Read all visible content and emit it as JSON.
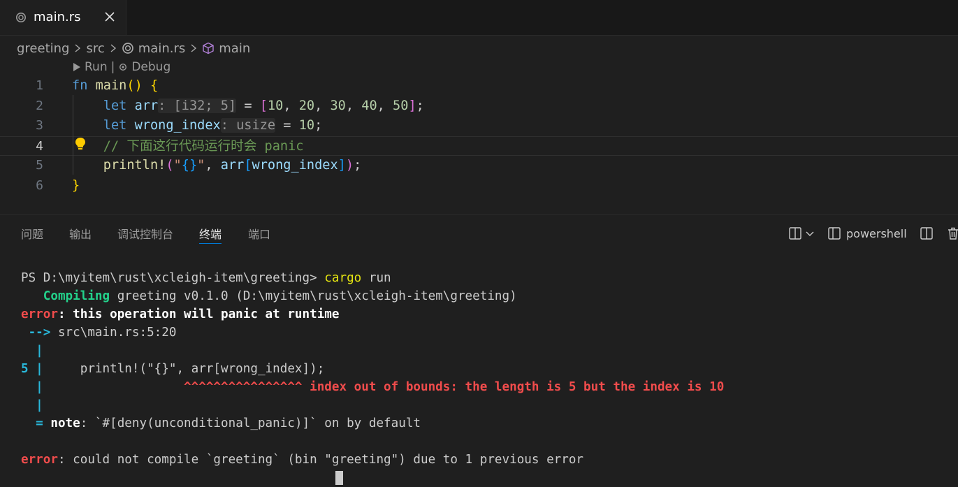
{
  "tab": {
    "label": "main.rs"
  },
  "breadcrumb": [
    "greeting",
    "src",
    "main.rs",
    "main"
  ],
  "codelens": {
    "run": "Run",
    "sep": "|",
    "debug": "Debug"
  },
  "editor": {
    "line_numbers": [
      "1",
      "2",
      "3",
      "4",
      "5",
      "6"
    ],
    "active_line": "4",
    "lines": [
      [
        [
          "kw",
          "fn"
        ],
        [
          "pun",
          " "
        ],
        [
          "fn",
          "main"
        ],
        [
          "br1",
          "()"
        ],
        [
          "pun",
          " "
        ],
        [
          "br1",
          "{"
        ]
      ],
      [
        [
          "pun",
          "    "
        ],
        [
          "kw",
          "let"
        ],
        [
          "pun",
          " "
        ],
        [
          "var",
          "arr"
        ],
        [
          "hint",
          ": [i32; 5]"
        ],
        [
          "pun",
          " = "
        ],
        [
          "br2",
          "["
        ],
        [
          "num",
          "10"
        ],
        [
          "pun",
          ", "
        ],
        [
          "num",
          "20"
        ],
        [
          "pun",
          ", "
        ],
        [
          "num",
          "30"
        ],
        [
          "pun",
          ", "
        ],
        [
          "num",
          "40"
        ],
        [
          "pun",
          ", "
        ],
        [
          "num",
          "50"
        ],
        [
          "br2",
          "]"
        ],
        [
          "pun",
          ";"
        ]
      ],
      [
        [
          "pun",
          "    "
        ],
        [
          "kw",
          "let"
        ],
        [
          "pun",
          " "
        ],
        [
          "var",
          "wrong_index"
        ],
        [
          "hint",
          ": usize"
        ],
        [
          "pun",
          " = "
        ],
        [
          "num",
          "10"
        ],
        [
          "pun",
          ";"
        ]
      ],
      [
        [
          "pun",
          "    "
        ],
        [
          "cmt",
          "// 下面这行代码运行时会 panic"
        ]
      ],
      [
        [
          "pun",
          "    "
        ],
        [
          "fn",
          "println!"
        ],
        [
          "br2",
          "("
        ],
        [
          "str",
          "\""
        ],
        [
          "br3",
          "{}"
        ],
        [
          "str",
          "\""
        ],
        [
          "pun",
          ", "
        ],
        [
          "var",
          "arr"
        ],
        [
          "br3",
          "["
        ],
        [
          "var",
          "wrong_index"
        ],
        [
          "br3",
          "]"
        ],
        [
          "br2",
          ")"
        ],
        [
          "pun",
          ";"
        ]
      ],
      [
        [
          "br1",
          "}"
        ]
      ]
    ]
  },
  "panel": {
    "tabs": [
      "问题",
      "输出",
      "调试控制台",
      "终端",
      "端口"
    ],
    "active_tab": "终端",
    "shell": "powershell"
  },
  "terminal": {
    "lines": [
      [
        [
          "",
          "PS D:\\myitem\\rust\\xcleigh-item\\greeting> "
        ],
        [
          "t-yellow",
          "cargo"
        ],
        [
          "",
          " run"
        ]
      ],
      [
        [
          "",
          "   "
        ],
        [
          "t-green",
          "Compiling"
        ],
        [
          "",
          " greeting v0.1.0 (D:\\myitem\\rust\\xcleigh-item\\greeting)"
        ]
      ],
      [
        [
          "t-red",
          "error"
        ],
        [
          "t-white-b",
          ": this operation will panic at runtime"
        ]
      ],
      [
        [
          "t-cyan-b",
          " -->"
        ],
        [
          "",
          " src\\main.rs:5:20"
        ]
      ],
      [
        [
          "t-cyan-b",
          "  |"
        ]
      ],
      [
        [
          "t-cyan-b",
          "5 |"
        ],
        [
          "",
          "     println!(\"{}\", arr[wrong_index]);"
        ]
      ],
      [
        [
          "t-cyan-b",
          "  |"
        ],
        [
          "",
          "                   "
        ],
        [
          "t-red",
          "^^^^^^^^^^^^^^^^ index out of bounds: the length is 5 but the index is 10"
        ]
      ],
      [
        [
          "t-cyan-b",
          "  |"
        ]
      ],
      [
        [
          "t-cyan-b",
          "  ="
        ],
        [
          "t-white-b",
          " note"
        ],
        [
          "",
          ": `#[deny(unconditional_panic)]` on by default"
        ]
      ],
      [
        [
          "",
          ""
        ]
      ],
      [
        [
          "t-red",
          "error"
        ],
        [
          "",
          ": could not compile `greeting` (bin \"greeting\") due to 1 previous error"
        ]
      ]
    ]
  },
  "colors": {
    "accent": "#0078d4",
    "background": "#1f1f1f"
  }
}
